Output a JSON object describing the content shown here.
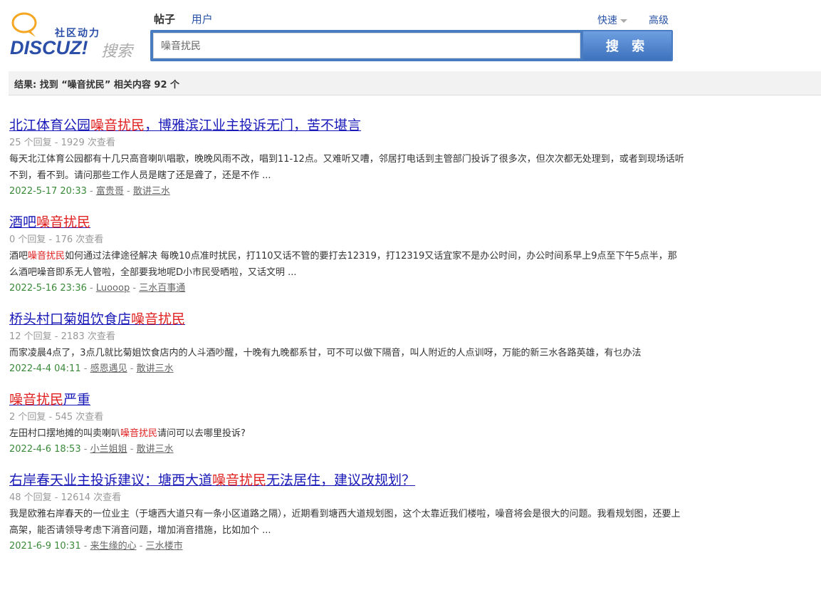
{
  "logo": {
    "tagline": "社区动力",
    "brand": "DISCUZ!",
    "sub": "搜索",
    "colors": {
      "bubble": "#f5a623",
      "brand": "#2b4fa8",
      "tagline": "#2b4fa8",
      "sub": "#aaaaaa"
    }
  },
  "tabs": [
    {
      "label": "帖子",
      "active": true
    },
    {
      "label": "用户",
      "active": false
    }
  ],
  "search": {
    "value": "噪音扰民",
    "button_label": "搜 索"
  },
  "links": {
    "quick": "快速",
    "advanced": "高级"
  },
  "summary": {
    "prefix": "结果: 找到 “",
    "keyword": "噪音扰民",
    "suffix": "” 相关内容 92 个"
  },
  "results": [
    {
      "title_pre": "北江体育公园",
      "title_hl": "噪音扰民",
      "title_post": "，博雅滨江业主投诉无门，苦不堪言",
      "meta": "25 个回复 - 1929 次查看",
      "snippet_pre": "每天北江体育公园都有十几只高音喇叭唱歌，晚晚风雨不改，唱到11-12点。又难听又嘈，邻居打电话到主管部门投诉了很多次，但次次都无处理到，或者到现场话听不到，看不到。请问那些工作人员是瞎了还是聋了，还是不作 ...",
      "snippet_hl": "",
      "snippet_post": "",
      "date": "2022-5-17 20:33",
      "author": "富贵哥",
      "forum": "散讲三水"
    },
    {
      "title_pre": "酒吧",
      "title_hl": "噪音扰民",
      "title_post": "",
      "meta": "0 个回复 - 176 次查看",
      "snippet_pre": "酒吧",
      "snippet_hl": "噪音扰民",
      "snippet_post": "如何通过法律途径解决 每晚10点准时扰民，打110又话不管的要打去12319，打12319又话宜家不是办公时间，办公时间系早上9点至下午5点半，那么酒吧噪音即系无人管啦，全部要我地呢D小市民受晒啦，又话文明 ...",
      "date": "2022-5-16 23:36",
      "author": "Luooop",
      "forum": "三水百事通"
    },
    {
      "title_pre": "桥头村口菊姐饮食店",
      "title_hl": "噪音扰民",
      "title_post": "",
      "meta": "12 个回复 - 2183 次查看",
      "snippet_pre": "而家凌晨4点了，3点几就比菊姐饮食店内的人斗酒吵醒，十晚有九晚都系甘，可不可以做下隔音，叫人附近的人点训呀，万能的新三水各路英雄，有乜办法",
      "snippet_hl": "",
      "snippet_post": "",
      "date": "2022-4-4 04:11",
      "author": "感恩遇见",
      "forum": "散讲三水"
    },
    {
      "title_pre": "",
      "title_hl": "噪音扰民",
      "title_post": "严重",
      "meta": "2 个回复 - 545 次查看",
      "snippet_pre": "左田村口摆地摊的叫卖喇叭",
      "snippet_hl": "噪音扰民",
      "snippet_post": "请问可以去哪里投诉?",
      "date": "2022-4-6 18:53",
      "author": "小兰姐姐",
      "forum": "散讲三水"
    },
    {
      "title_pre": "右岸春天业主投诉建议：塘西大道",
      "title_hl": "噪音扰民",
      "title_post": "无法居住，建议改规划？",
      "meta": "48 个回复 - 12614 次查看",
      "snippet_pre": "我是欧雅右岸春天的一位业主（于塘西大道只有一条小区道路之隔），近期看到塘西大道规划图，这个太靠近我们楼啦，噪音将会是很大的问题。我看规划图，还要上高架，能否请领导考虑下消音问题，增加消音措施，比如加个 ...",
      "snippet_hl": "",
      "snippet_post": "",
      "date": "2021-6-9 10:31",
      "author": "来生缘的心",
      "forum": "三水楼市"
    }
  ]
}
